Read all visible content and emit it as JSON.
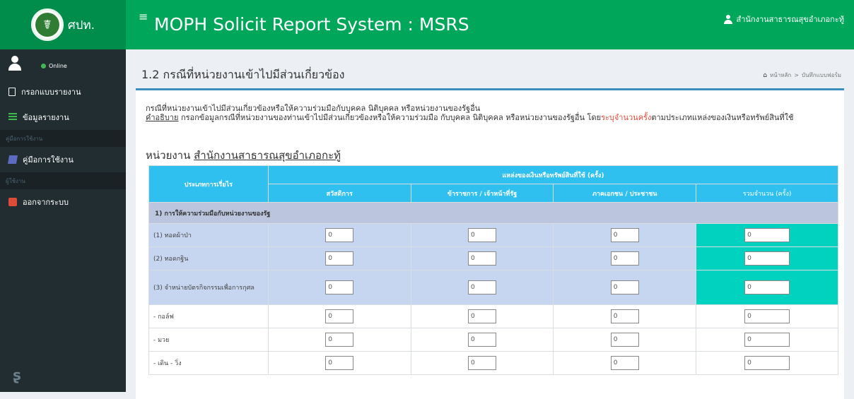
{
  "header": {
    "logo_text": "ศปท.",
    "title": "MOPH Solicit Report System : MSRS",
    "user_name": "สำนักงานสาธารณสุขอำเภอกะทู้"
  },
  "sidebar": {
    "status": "Online",
    "items": [
      {
        "label": "กรอกแบบรายงาน",
        "icon": "file-icon"
      },
      {
        "label": "ข้อมูลรายงาน",
        "icon": "list-icon"
      }
    ],
    "section_manual": "คู่มือการใช้งาน",
    "manual_item": "คู่มือการใช้งาน",
    "section_user": "ผู้ใช้งาน",
    "logout_item": "ออกจากระบบ"
  },
  "page": {
    "title": "1.2 กรณีที่หน่วยงานเข้าไปมีส่วนเกี่ยวข้อง",
    "breadcrumb_home": "หน้าหลัก",
    "breadcrumb_sep": ">",
    "breadcrumb_current": "บันทึกแบบฟอร์ม"
  },
  "description": {
    "line1": "กรณีที่หน่วยงานเข้าไปมีส่วนเกี่ยวข้องหรือให้ความร่วมมือกับบุคคล นิติบุคคล หรือหน่วยงานของรัฐอื่น",
    "label": "คำอธิบาย",
    "text": " กรอกข้อมูลกรณีที่หน่วยงานของท่านเข้าไปมีส่วนเกี่ยวข้องหรือให้ความร่วมมือ กับบุคคล นิติบุคคล หรือหน่วยงานของรัฐอื่น โดย",
    "highlight": "ระบุจำนวนครั้ง",
    "tail": "ตามประเภทแหล่งของเงินหรือทรัพย์สินที่ใช้"
  },
  "unit": {
    "label": "หน่วยงาน ",
    "name": "สำนักงานสาธารณสุขอำเภอกะทู้"
  },
  "table": {
    "head_type": "ประเภทการเรี่ยไร",
    "head_source": "แหล่งของเงินหรือทรัพย์สินที่ใช้ (ครั้ง)",
    "columns": [
      "สวัสดิการ",
      "ข้าราชการ / เจ้าหน้าที่รัฐ",
      "ภาคเอกชน / ประชาชน",
      "รวมจำนวน (ครั้ง)"
    ],
    "section1": "1) การให้ความร่วมมือกับหน่วยงานของรัฐ",
    "rows": [
      {
        "label": "(1) ทอดผ้าป่า",
        "values": [
          "0",
          "0",
          "0",
          "0"
        ]
      },
      {
        "label": "(2) ทอดกฐิน",
        "values": [
          "0",
          "0",
          "0",
          "0"
        ]
      },
      {
        "label": "(3) จำหน่ายบัตรกิจกรรมเพื่อการกุศล",
        "values": [
          "0",
          "0",
          "0",
          "0"
        ]
      },
      {
        "label": "- กอล์ฟ",
        "values": [
          "0",
          "0",
          "0",
          "0"
        ]
      },
      {
        "label": "- มวย",
        "values": [
          "0",
          "0",
          "0",
          "0"
        ]
      },
      {
        "label": "- เดิน - วิ่ง",
        "values": [
          "0",
          "0",
          "0",
          "0"
        ]
      }
    ]
  }
}
